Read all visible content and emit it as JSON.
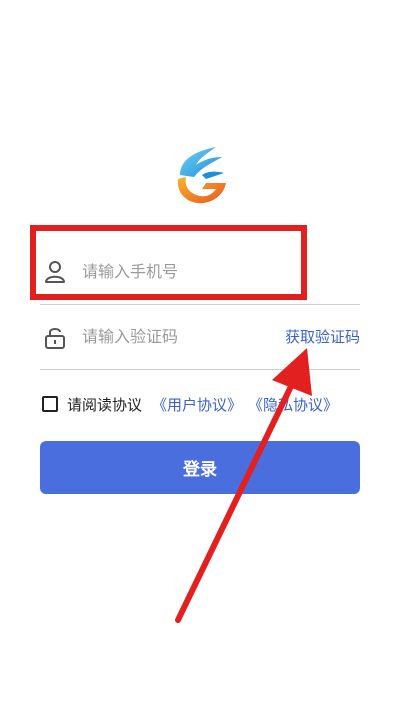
{
  "login": {
    "phone_placeholder": "请输入手机号",
    "code_placeholder": "请输入验证码",
    "get_code_label": "获取验证码",
    "agreement_text": "请阅读协议",
    "user_agreement_link": "《用户协议》",
    "privacy_link": "《隐私协议》",
    "login_button_label": "登录"
  },
  "icons": {
    "logo": "brand-logo-icon",
    "phone": "user-icon",
    "code": "lock-icon"
  },
  "colors": {
    "accent": "#4a6ede",
    "link": "#3a63c9",
    "annotation": "#e32020"
  }
}
